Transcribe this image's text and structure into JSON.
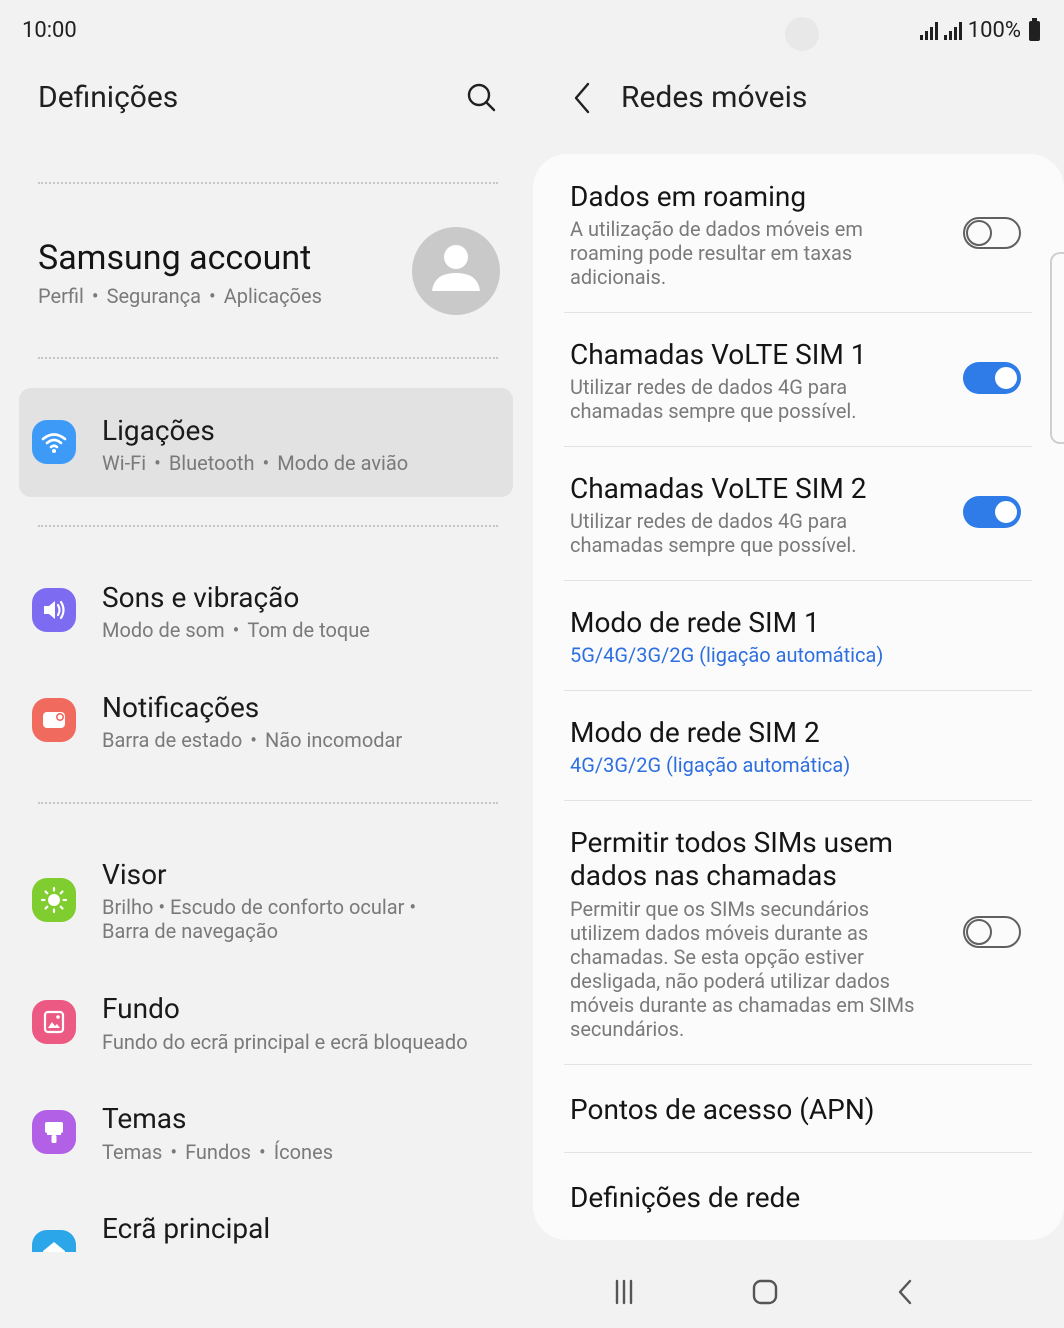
{
  "status_bar": {
    "time": "10:00",
    "battery": "100%"
  },
  "left_panel": {
    "title": "Definições",
    "account": {
      "name": "Samsung account",
      "subtitle": [
        "Perfil",
        "Segurança",
        "Aplicações"
      ]
    },
    "items": [
      {
        "id": "ligacoes",
        "title": "Ligações",
        "subtitle": [
          "Wi-Fi",
          "Bluetooth",
          "Modo de avião"
        ],
        "icon": "wifi-icon",
        "color": "#3d9bf7",
        "selected": true
      },
      {
        "id": "sons",
        "title": "Sons e vibração",
        "subtitle": [
          "Modo de som",
          "Tom de toque"
        ],
        "icon": "volume-icon",
        "color": "#7d6cf2"
      },
      {
        "id": "notificacoes",
        "title": "Notificações",
        "subtitle": [
          "Barra de estado",
          "Não incomodar"
        ],
        "icon": "notification-icon",
        "color": "#f06a5e"
      },
      {
        "id": "visor",
        "title": "Visor",
        "subtitle_line1": "Brilho  •  Escudo de conforto ocular  •",
        "subtitle_line2": "Barra de navegação",
        "icon": "brightness-icon",
        "color": "#7fcd2e"
      },
      {
        "id": "fundo",
        "title": "Fundo",
        "subtitle": [
          "Fundo do ecrã principal e ecrã bloqueado"
        ],
        "icon": "wallpaper-icon",
        "color": "#ec5a83"
      },
      {
        "id": "temas",
        "title": "Temas",
        "subtitle": [
          "Temas",
          "Fundos",
          "Ícones"
        ],
        "icon": "paintbrush-icon",
        "color": "#b261e6"
      },
      {
        "id": "ecra",
        "title": "Ecrã principal",
        "icon": "home-icon",
        "color": "#2ba6e8"
      }
    ]
  },
  "right_panel": {
    "title": "Redes móveis",
    "settings": [
      {
        "id": "roaming",
        "title": "Dados em roaming",
        "description": "A utilização de dados móveis em roaming pode resultar em taxas adicionais.",
        "toggle": false
      },
      {
        "id": "volte1",
        "title": "Chamadas VoLTE SIM 1",
        "description": "Utilizar redes de dados 4G para chamadas sempre que possível.",
        "toggle": true
      },
      {
        "id": "volte2",
        "title": "Chamadas VoLTE SIM 2",
        "description": "Utilizar redes de dados 4G para chamadas sempre que possível.",
        "toggle": true
      },
      {
        "id": "modo1",
        "title": "Modo de rede SIM 1",
        "value": "5G/4G/3G/2G (ligação automática)"
      },
      {
        "id": "modo2",
        "title": "Modo de rede SIM 2",
        "value": "4G/3G/2G (ligação automática)"
      },
      {
        "id": "permitir",
        "title_line1": "Permitir todos SIMs usem",
        "title_line2": "dados nas chamadas",
        "description": "Permitir que os SIMs secundários utilizem dados móveis durante as chamadas. Se esta opção estiver desligada, não poderá utilizar dados móveis durante as chamadas em SIMs secundários.",
        "toggle": false
      },
      {
        "id": "apn",
        "title": "Pontos de acesso (APN)"
      },
      {
        "id": "rede",
        "title": "Definições de rede"
      }
    ]
  },
  "nav_bar": {
    "recents": "recents-icon",
    "home": "home-button-icon",
    "back": "back-icon"
  },
  "colors": {
    "accent": "#2f7ce8",
    "link": "#2e6fe0",
    "background": "#f2f2f2",
    "card": "#fbfbfb"
  }
}
